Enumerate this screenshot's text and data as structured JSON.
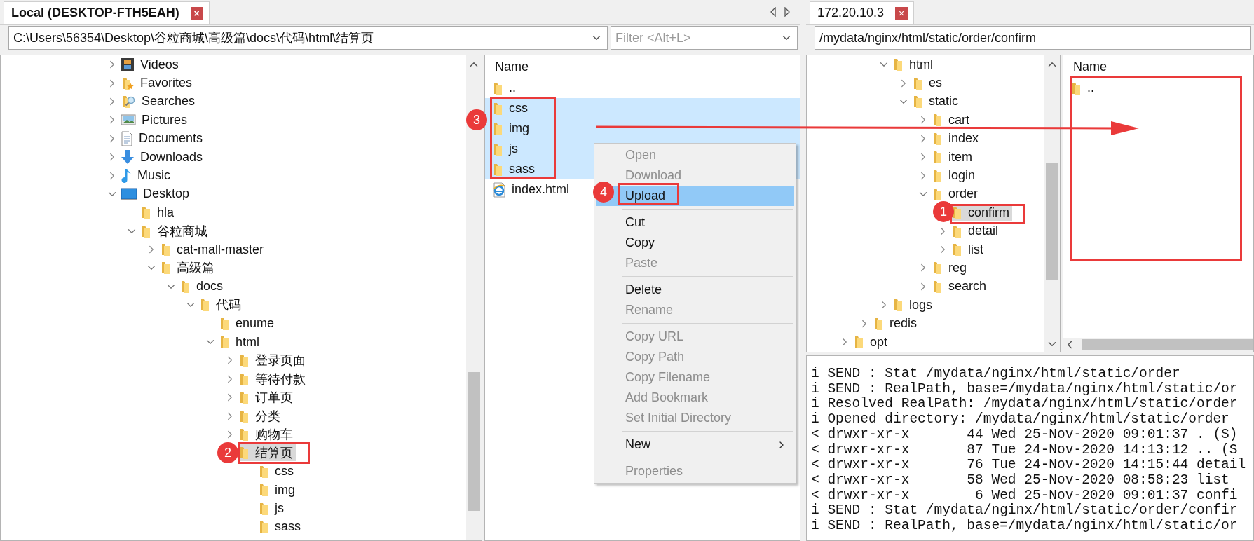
{
  "local_pane": {
    "tab": {
      "title": "Local (DESKTOP-FTH5EAH)",
      "selected": true,
      "close": "×"
    },
    "path": "C:\\Users\\56354\\Desktop\\谷粒商城\\高级篇\\docs\\代码\\html\\结算页",
    "filter": {
      "placeholder": "Filter <Alt+L>"
    },
    "tree": [
      {
        "label": "Videos",
        "kind": "video",
        "expanded": false,
        "selected": false
      },
      {
        "label": "Favorites",
        "kind": "favorites",
        "expanded": false,
        "selected": false
      },
      {
        "label": "Searches",
        "kind": "searches",
        "expanded": false,
        "selected": false
      },
      {
        "label": "Pictures",
        "kind": "pictures",
        "expanded": false,
        "selected": false
      },
      {
        "label": "Documents",
        "kind": "documents",
        "expanded": false,
        "selected": false
      },
      {
        "label": "Downloads",
        "kind": "downloads",
        "expanded": false,
        "selected": false
      },
      {
        "label": "Music",
        "kind": "music",
        "expanded": false,
        "selected": false
      },
      {
        "label": "Desktop",
        "kind": "desktop",
        "expanded": true,
        "selected": false,
        "children": [
          {
            "label": "hla",
            "kind": "folder",
            "selected": false
          },
          {
            "label": "谷粒商城",
            "kind": "folder",
            "expanded": true,
            "selected": false,
            "children": [
              {
                "label": "cat-mall-master",
                "kind": "folder",
                "expanded": false,
                "selected": false
              },
              {
                "label": "高级篇",
                "kind": "folder",
                "expanded": true,
                "selected": false,
                "children": [
                  {
                    "label": "docs",
                    "kind": "folder",
                    "expanded": true,
                    "selected": false,
                    "children": [
                      {
                        "label": "代码",
                        "kind": "folder",
                        "expanded": true,
                        "selected": false,
                        "children": [
                          {
                            "label": "enume",
                            "kind": "folder",
                            "selected": false
                          },
                          {
                            "label": "html",
                            "kind": "folder",
                            "expanded": true,
                            "selected": false,
                            "children": [
                              {
                                "label": "登录页面",
                                "kind": "folder",
                                "expanded": false,
                                "selected": false
                              },
                              {
                                "label": "等待付款",
                                "kind": "folder",
                                "expanded": false,
                                "selected": false
                              },
                              {
                                "label": "订单页",
                                "kind": "folder",
                                "expanded": false,
                                "selected": false
                              },
                              {
                                "label": "分类",
                                "kind": "folder",
                                "expanded": false,
                                "selected": false
                              },
                              {
                                "label": "购物车",
                                "kind": "folder",
                                "expanded": false,
                                "selected": false
                              },
                              {
                                "label": "结算页",
                                "kind": "folder",
                                "selected": true,
                                "children": [
                                  {
                                    "label": "css",
                                    "kind": "folder",
                                    "selected": false
                                  },
                                  {
                                    "label": "img",
                                    "kind": "folder",
                                    "selected": false
                                  },
                                  {
                                    "label": "js",
                                    "kind": "folder",
                                    "selected": false
                                  },
                                  {
                                    "label": "sass",
                                    "kind": "folder",
                                    "selected": false
                                  }
                                ]
                              }
                            ]
                          }
                        ]
                      }
                    ]
                  }
                ]
              }
            ]
          }
        ]
      }
    ],
    "list": {
      "column": "Name",
      "items": [
        {
          "name": "..",
          "kind": "folder",
          "selected": false
        },
        {
          "name": "css",
          "kind": "folder",
          "selected": true
        },
        {
          "name": "img",
          "kind": "folder",
          "selected": true
        },
        {
          "name": "js",
          "kind": "folder",
          "selected": true
        },
        {
          "name": "sass",
          "kind": "folder",
          "selected": true
        },
        {
          "name": "index.html",
          "kind": "html",
          "selected": false
        }
      ]
    }
  },
  "context_menu": [
    {
      "kind": "item",
      "label": "Open",
      "disabled": true,
      "selected": false
    },
    {
      "kind": "item",
      "label": "Download",
      "disabled": true,
      "selected": false
    },
    {
      "kind": "item",
      "label": "Upload",
      "disabled": false,
      "selected": true
    },
    {
      "kind": "separator"
    },
    {
      "kind": "item",
      "label": "Cut",
      "disabled": false,
      "selected": false
    },
    {
      "kind": "item",
      "label": "Copy",
      "disabled": false,
      "selected": false
    },
    {
      "kind": "item",
      "label": "Paste",
      "disabled": true,
      "selected": false
    },
    {
      "kind": "separator"
    },
    {
      "kind": "item",
      "label": "Delete",
      "disabled": false,
      "selected": false
    },
    {
      "kind": "item",
      "label": "Rename",
      "disabled": true,
      "selected": false
    },
    {
      "kind": "separator"
    },
    {
      "kind": "item",
      "label": "Copy URL",
      "disabled": true,
      "selected": false
    },
    {
      "kind": "item",
      "label": "Copy Path",
      "disabled": true,
      "selected": false
    },
    {
      "kind": "item",
      "label": "Copy Filename",
      "disabled": true,
      "selected": false
    },
    {
      "kind": "item",
      "label": "Add Bookmark",
      "disabled": true,
      "selected": false
    },
    {
      "kind": "item",
      "label": "Set Initial Directory",
      "disabled": true,
      "selected": false
    },
    {
      "kind": "separator"
    },
    {
      "kind": "submenu",
      "label": "New",
      "disabled": false,
      "selected": false
    },
    {
      "kind": "separator"
    },
    {
      "kind": "item",
      "label": "Properties",
      "disabled": true,
      "selected": false
    }
  ],
  "remote_pane": {
    "tab": {
      "title": "172.20.10.3",
      "selected": false,
      "close": "×"
    },
    "path": "/mydata/nginx/html/static/order/confirm",
    "tree": [
      {
        "children": [
          {
            "children": [
              {
                "label": "html",
                "kind": "folder",
                "expanded": true,
                "selected": false,
                "children": [
                  {
                    "label": "es",
                    "kind": "folder",
                    "expanded": false,
                    "selected": false
                  },
                  {
                    "label": "static",
                    "kind": "folder",
                    "expanded": true,
                    "selected": false,
                    "children": [
                      {
                        "label": "cart",
                        "kind": "folder",
                        "expanded": false,
                        "selected": false
                      },
                      {
                        "label": "index",
                        "kind": "folder",
                        "expanded": false,
                        "selected": false
                      },
                      {
                        "label": "item",
                        "kind": "folder",
                        "expanded": false,
                        "selected": false
                      },
                      {
                        "label": "login",
                        "kind": "folder",
                        "expanded": false,
                        "selected": false
                      },
                      {
                        "label": "order",
                        "kind": "folder",
                        "expanded": true,
                        "selected": false,
                        "children": [
                          {
                            "label": "confirm",
                            "kind": "folder",
                            "selected": true
                          },
                          {
                            "label": "detail",
                            "kind": "folder",
                            "expanded": false,
                            "selected": false
                          },
                          {
                            "label": "list",
                            "kind": "folder",
                            "expanded": false,
                            "selected": false
                          }
                        ]
                      },
                      {
                        "label": "reg",
                        "kind": "folder",
                        "expanded": false,
                        "selected": false
                      },
                      {
                        "label": "search",
                        "kind": "folder",
                        "expanded": false,
                        "selected": false
                      }
                    ]
                  }
                ]
              },
              {
                "label": "logs",
                "kind": "folder",
                "expanded": false,
                "selected": false
              }
            ]
          },
          {
            "label": "redis",
            "kind": "folder",
            "expanded": false,
            "selected": false
          }
        ]
      },
      {
        "label": "opt",
        "kind": "folder",
        "expanded": false,
        "selected": false
      }
    ],
    "list": {
      "column": "Name",
      "items": [
        {
          "name": "..",
          "kind": "folder",
          "selected": false
        }
      ]
    },
    "log": [
      "i SEND : Stat /mydata/nginx/html/static/order",
      "i SEND : RealPath, base=/mydata/nginx/html/static/or",
      "i Resolved RealPath: /mydata/nginx/html/static/order",
      "i Opened directory: /mydata/nginx/html/static/order",
      "< drwxr-xr-x       44 Wed 25-Nov-2020 09:01:37 . (S)",
      "< drwxr-xr-x       87 Tue 24-Nov-2020 14:13:12 .. (S",
      "< drwxr-xr-x       76 Tue 24-Nov-2020 14:15:44 detail",
      "< drwxr-xr-x       58 Wed 25-Nov-2020 08:58:23 list",
      "< drwxr-xr-x        6 Wed 25-Nov-2020 09:01:37 confi",
      "i SEND : Stat /mydata/nginx/html/static/order/confir",
      "i SEND : RealPath, base=/mydata/nginx/html/static/or"
    ]
  },
  "annotations": [
    {
      "label": "1"
    },
    {
      "label": "2"
    },
    {
      "label": "3"
    },
    {
      "label": "4"
    }
  ]
}
